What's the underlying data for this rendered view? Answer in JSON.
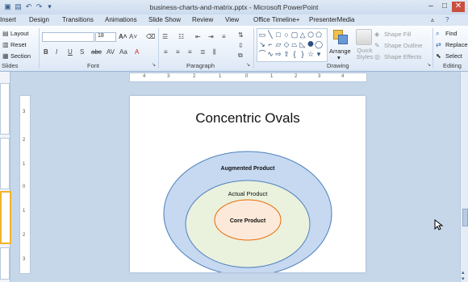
{
  "window": {
    "title": "business-charts-and-matrix.pptx - Microsoft PowerPoint"
  },
  "tabs": [
    "Insert",
    "Design",
    "Transitions",
    "Animations",
    "Slide Show",
    "Review",
    "View",
    "Office Timeline+",
    "PresenterMedia"
  ],
  "ribbon": {
    "slides": {
      "layout": "Layout",
      "reset": "Reset",
      "section": "Section",
      "label": "Slides"
    },
    "font": {
      "size": "18",
      "label": "Font"
    },
    "paragraph": {
      "label": "Paragraph"
    },
    "drawing": {
      "arrange": "Arrange",
      "quick_styles": "Quick Styles",
      "shape_fill": "Shape Fill",
      "shape_outline": "Shape Outline",
      "shape_effects": "Shape Effects",
      "label": "Drawing"
    },
    "editing": {
      "find": "Find",
      "replace": "Replace",
      "select": "Select",
      "label": "Editing"
    }
  },
  "ruler": {
    "horizontal": [
      "4",
      "3",
      "2",
      "1",
      "0",
      "1",
      "2",
      "3",
      "4"
    ],
    "vertical": [
      "3",
      "2",
      "1",
      "0",
      "1",
      "2",
      "3"
    ]
  },
  "slide": {
    "title": "Concentric Ovals",
    "ovals": {
      "outer": {
        "label": "Augmented Product",
        "color": "#c6d9f1"
      },
      "middle": {
        "label": "Actual Product",
        "color": "#eaf1dd"
      },
      "inner": {
        "label": "Core Product",
        "color": "#fde9d9"
      }
    }
  }
}
